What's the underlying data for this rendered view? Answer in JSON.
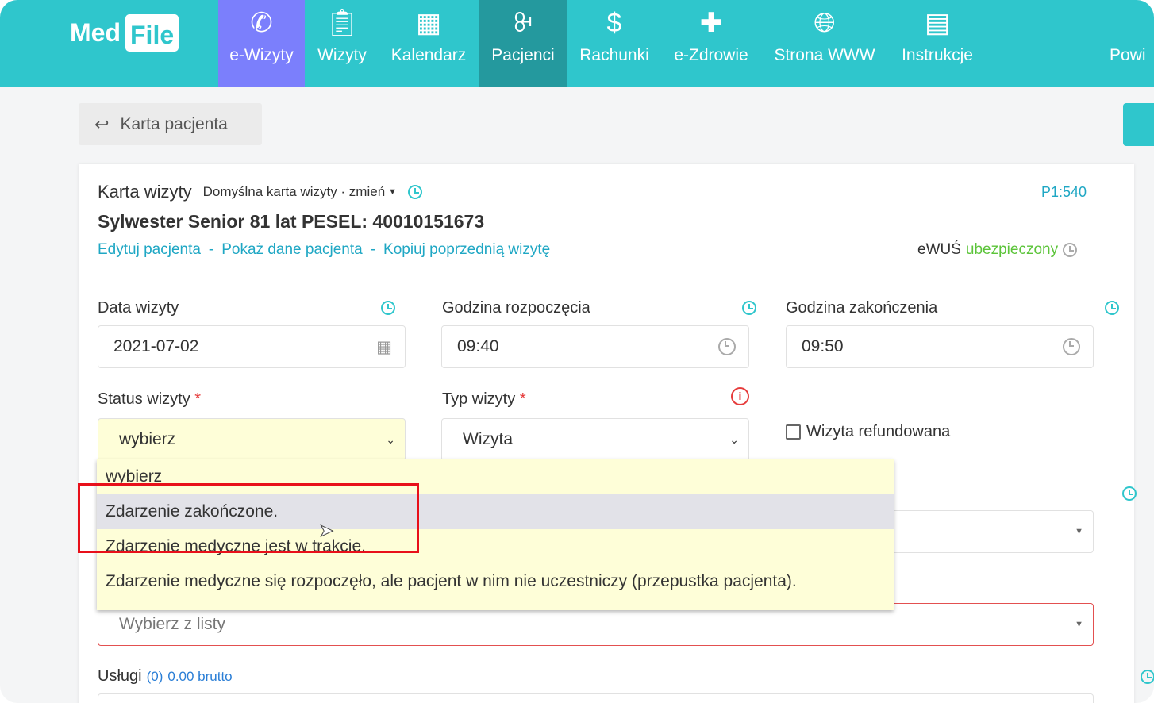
{
  "nav": {
    "logo": "MedFile",
    "logo_a": "Med",
    "logo_b": "File",
    "items": [
      {
        "label": "e-Wizyty",
        "icon": "phone-icon"
      },
      {
        "label": "Wizyty",
        "icon": "clipboard-icon"
      },
      {
        "label": "Kalendarz",
        "icon": "calendar-icon"
      },
      {
        "label": "Pacjenci",
        "icon": "users-icon"
      },
      {
        "label": "Rachunki",
        "icon": "dollar-icon"
      },
      {
        "label": "e-Zdrowie",
        "icon": "medical-icon"
      },
      {
        "label": "Strona WWW",
        "icon": "globe-icon"
      },
      {
        "label": "Instrukcje",
        "icon": "book-icon"
      },
      {
        "label": "Powi",
        "icon": ""
      }
    ]
  },
  "back_label": "Karta pacjenta",
  "card": {
    "title": "Karta wizyty",
    "template": "Domyślna karta wizyty · zmień",
    "code": "P1:540",
    "patient": "Sylwester Senior 81 lat PESEL: 40010151673",
    "links": [
      "Edytuj pacjenta",
      "Pokaż dane pacjenta",
      "Kopiuj poprzednią wizytę"
    ],
    "sep": "-",
    "ewus_label": "eWUŚ",
    "ewus_status": "ubezpieczony",
    "date_label": "Data wizyty",
    "date_value": "2021-07-02",
    "start_label": "Godzina rozpoczęcia",
    "start_value": "09:40",
    "end_label": "Godzina zakończenia",
    "end_value": "09:50",
    "status_label": "Status wizyty",
    "status_value": "wybierz",
    "type_label": "Typ wizyty",
    "type_value": "Wizyta",
    "refund_label": "Wizyta refundowana",
    "refund_checked": false,
    "list_placeholder": "Wybierz z listy",
    "services_label": "Usługi",
    "services_count": "(0)",
    "services_total": "0.00 brutto"
  },
  "dropdown": {
    "options": [
      "wybierz",
      "Zdarzenie zakończone.",
      "Zdarzenie medyczne jest w trakcie.",
      "Zdarzenie medyczne się rozpoczęło, ale pacjent w nim nie uczestniczy (przepustka pacjenta)."
    ],
    "highlighted": 1
  },
  "colors": {
    "nav": "#2fc6cc",
    "active": "#7b7ffc",
    "current": "#24999e",
    "link": "#1fa7c4",
    "insured": "#5cc43a",
    "highlight_box": "#e8101a"
  }
}
